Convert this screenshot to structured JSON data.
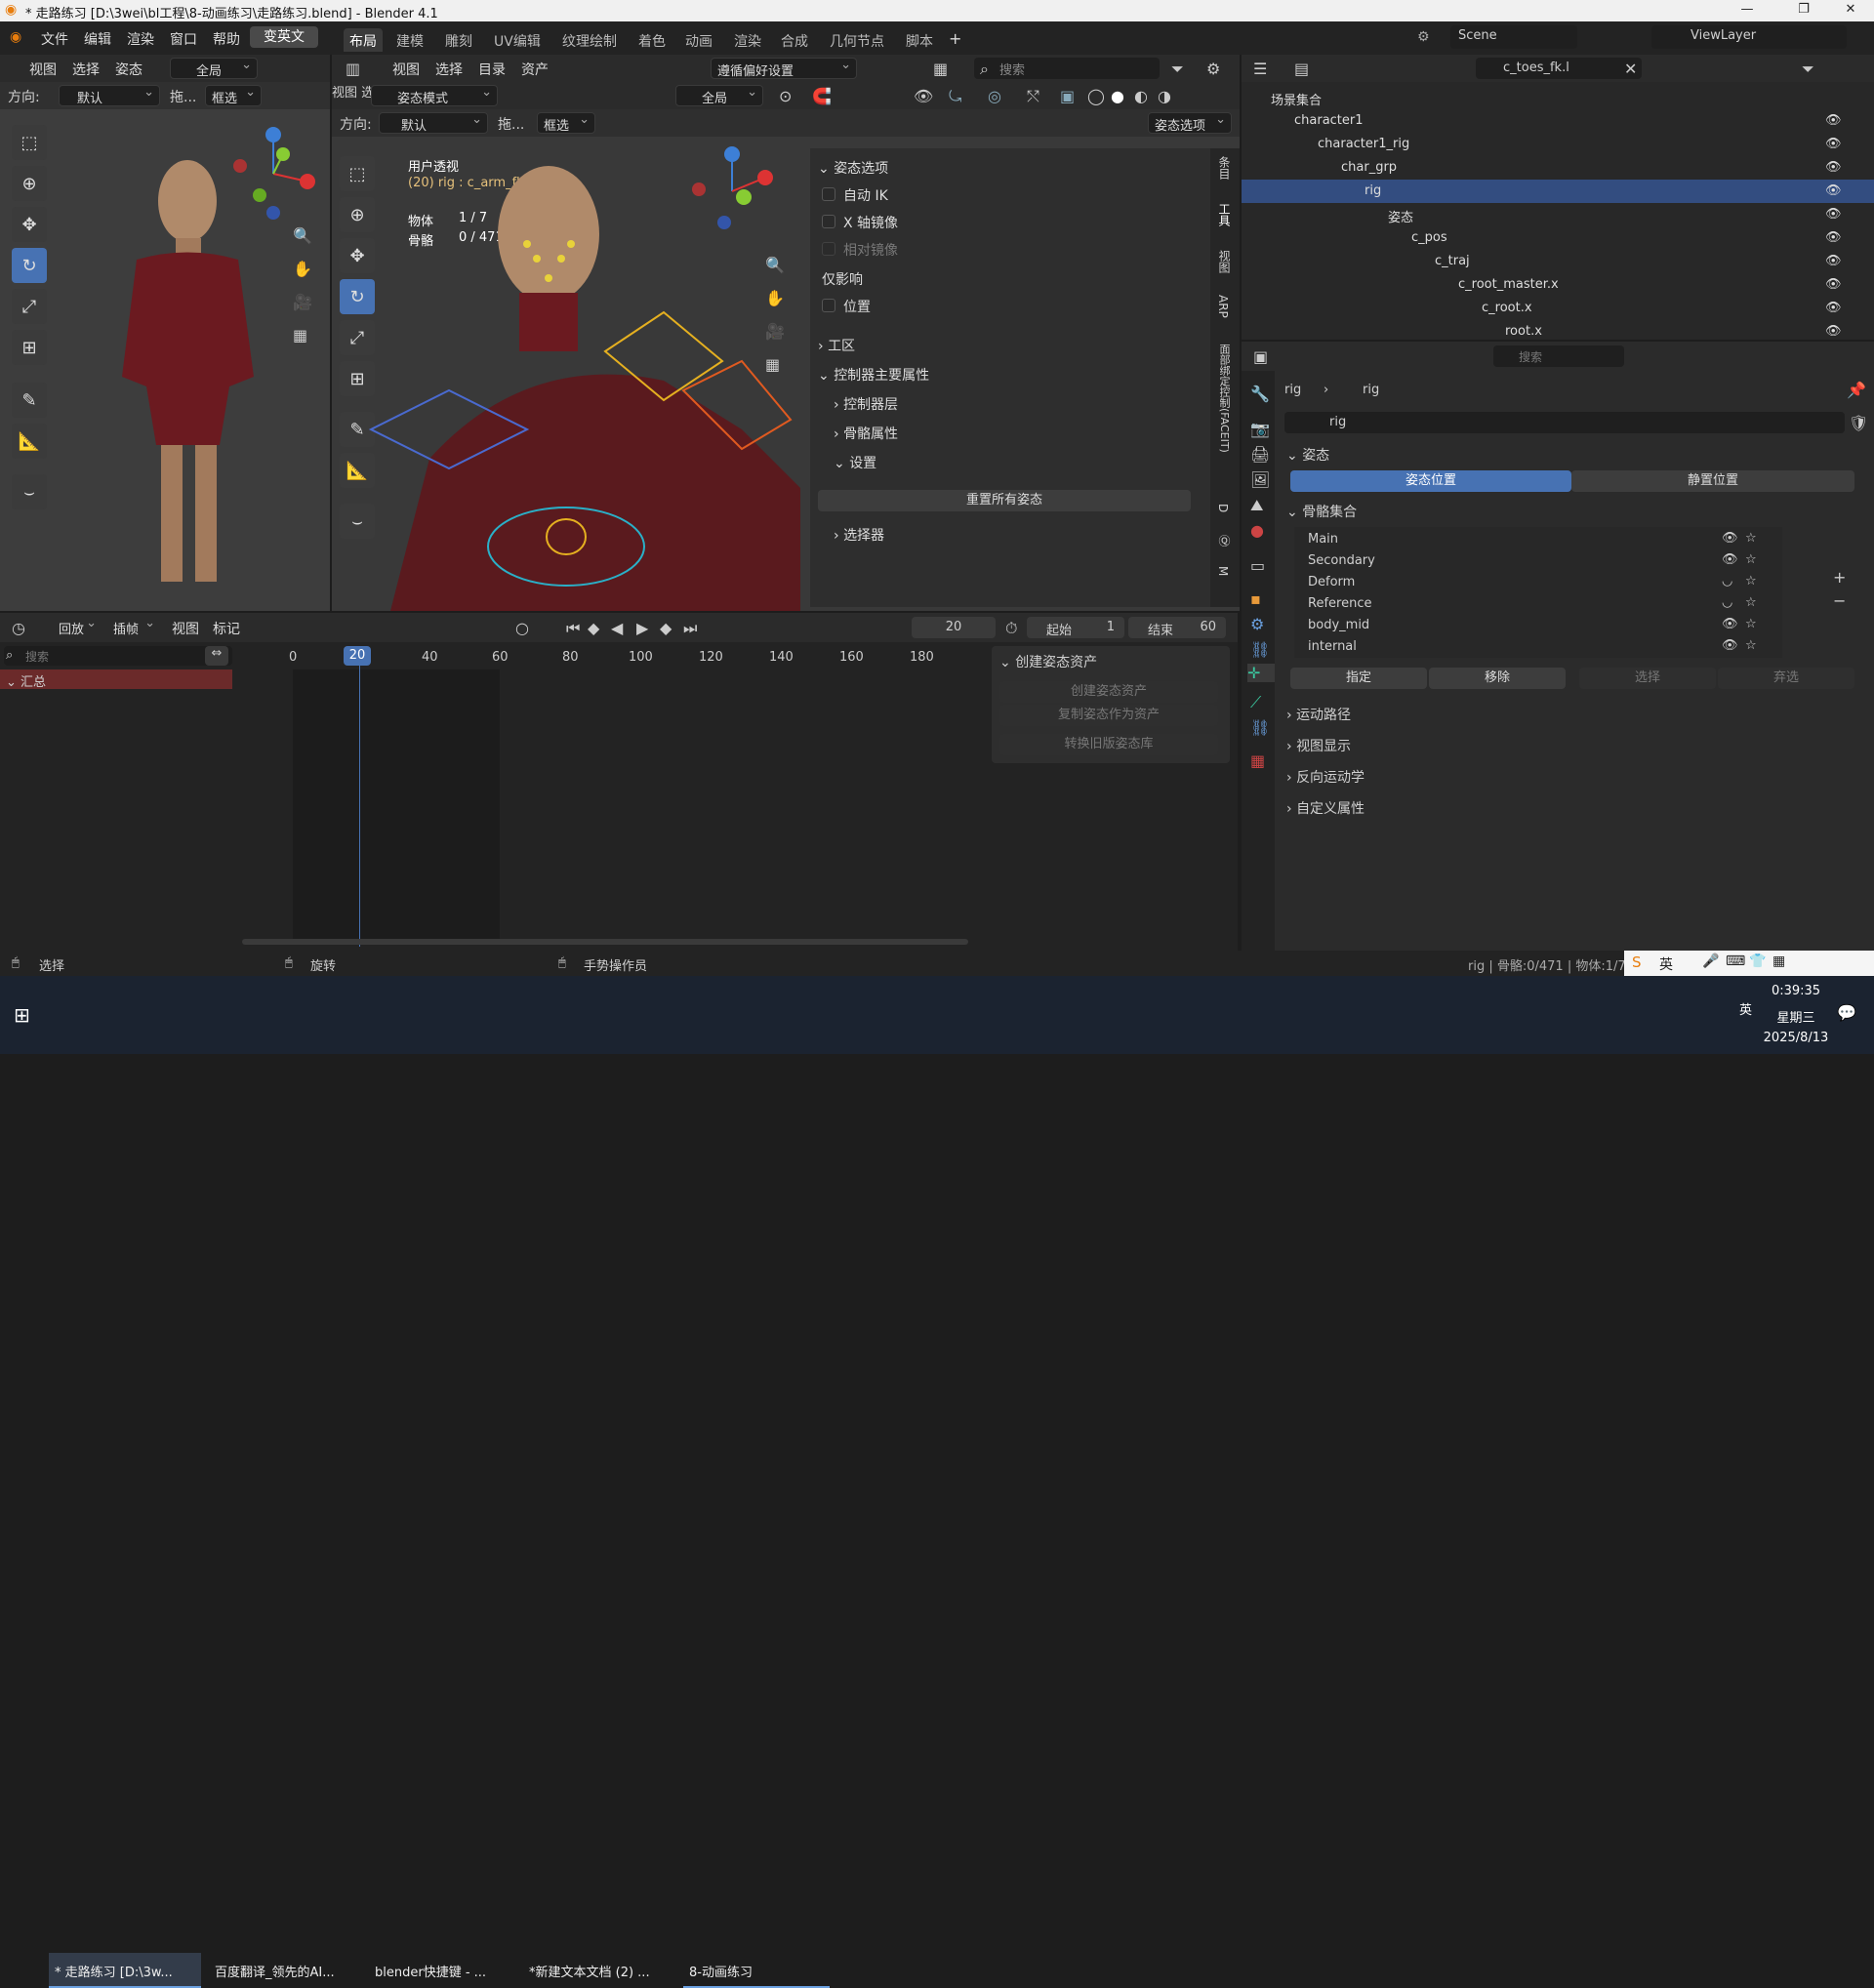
{
  "window": {
    "title": "* 走路练习 [D:\\3wei\\bl工程\\8-动画练习\\走路练习.blend] - Blender 4.1",
    "min": "—",
    "max": "❐",
    "close": "✕"
  },
  "menu": {
    "items": [
      "文件",
      "编辑",
      "渲染",
      "窗口",
      "帮助"
    ],
    "lang_btn": "变英文"
  },
  "workspaces": [
    "布局",
    "建模",
    "雕刻",
    "UV编辑",
    "纹理绘制",
    "着色",
    "动画",
    "渲染",
    "合成",
    "几何节点",
    "脚本"
  ],
  "scene": {
    "name": "Scene",
    "view_layer": "ViewLayer"
  },
  "left_view": {
    "menu": [
      "视图",
      "选择",
      "姿态"
    ],
    "transform": "全局",
    "orient_label": "方向:",
    "orient_value": "默认",
    "drag": "拖...",
    "select": "框选"
  },
  "main_view": {
    "menu": [
      "视图",
      "选择",
      "目录",
      "资产"
    ],
    "pref": "遵循偏好设置",
    "search_placeholder": "搜索",
    "mode": "姿态模式",
    "menu2": [
      "视图",
      "选择",
      "姿态"
    ],
    "transform": "全局",
    "orient_label": "方向:",
    "orient_value": "默认",
    "drag": "拖...",
    "select": "框选",
    "pose_options": "姿态选项",
    "overlay_title": "用户透视",
    "overlay_sub": "(20) rig : c_arm_fk.l",
    "stats_obj_label": "物体",
    "stats_obj": "1 / 7",
    "stats_bone_label": "骨骼",
    "stats_bone": "0 / 471"
  },
  "npanel": {
    "pose_options": "姿态选项",
    "auto_ik": "自动 IK",
    "x_mirror": "X 轴镜像",
    "rel_mirror": "相对镜像",
    "affect_only": "仅影响",
    "location": "位置",
    "workspace": "工区",
    "ctrl_main": "控制器主要属性",
    "ctrl_layer": "控制器层",
    "bone_props": "骨骼属性",
    "settings": "设置",
    "reset_all": "重置所有姿态",
    "picker": "选择器",
    "tabs": [
      "条目",
      "工具",
      "视图",
      "ARP",
      "面部绑定控制(FACEIT)",
      "D",
      "Ⓠ",
      "M"
    ]
  },
  "timeline": {
    "menu": [
      "回放",
      "插帧",
      "视图",
      "标记"
    ],
    "current": "20",
    "start_label": "起始",
    "start": "1",
    "end_label": "结束",
    "end": "60",
    "ticks": [
      "0",
      "20",
      "40",
      "60",
      "80",
      "100",
      "120",
      "140",
      "160",
      "180"
    ],
    "search_placeholder": "搜索",
    "summary": "汇总"
  },
  "pose_asset": {
    "title": "创建姿态资产",
    "create": "创建姿态资产",
    "copy": "复制姿态作为资产",
    "convert": "转换旧版姿态库"
  },
  "outliner": {
    "search": "c_toes_fk.l",
    "rows": [
      {
        "label": "场景集合",
        "indent": 0
      },
      {
        "label": "character1",
        "indent": 1
      },
      {
        "label": "character1_rig",
        "indent": 2
      },
      {
        "label": "char_grp",
        "indent": 3
      },
      {
        "label": "rig",
        "indent": 4
      },
      {
        "label": "姿态",
        "indent": 5
      },
      {
        "label": "c_pos",
        "indent": 6
      },
      {
        "label": "c_traj",
        "indent": 7
      },
      {
        "label": "c_root_master.x",
        "indent": 8
      },
      {
        "label": "c_root.x",
        "indent": 9
      },
      {
        "label": "root.x",
        "indent": 10
      }
    ]
  },
  "properties": {
    "search_placeholder": "搜索",
    "breadcrumb": [
      "rig",
      "rig"
    ],
    "name": "rig",
    "pose": "姿态",
    "pose_position": "姿态位置",
    "rest_position": "静置位置",
    "bone_collections": "骨骼集合",
    "collections": [
      "Main",
      "Secondary",
      "Deform",
      "Reference",
      "body_mid",
      "internal"
    ],
    "assign": "指定",
    "remove": "移除",
    "select": "选择",
    "deselect": "弃选",
    "motion_paths": "运动路径",
    "viewport_display": "视图显示",
    "ik": "反向运动学",
    "custom_props": "自定义属性"
  },
  "status": {
    "left": "选择",
    "mid": "旋转",
    "right": "手势操作员",
    "info": "rig | 骨骼:0/471 | 物体:1/7"
  },
  "taskbar": {
    "items": [
      "* 走路练习 [D:\\3w...",
      "百度翻译_领先的AI...",
      "blender快捷键 - ...",
      "*新建文本文档 (2) ...",
      "8-动画练习"
    ],
    "ime": "英",
    "ime2": "英",
    "time": "0:39:35",
    "weekday": "星期三",
    "date": "2025/8/13"
  }
}
